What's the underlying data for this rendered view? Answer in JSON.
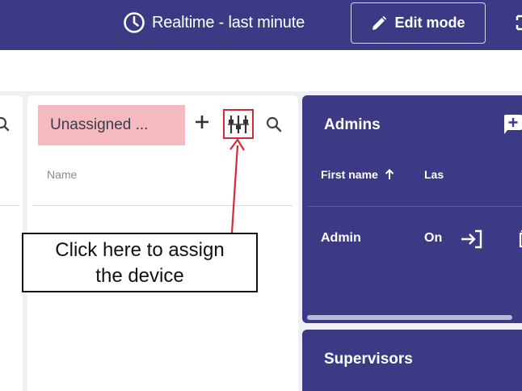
{
  "header": {
    "realtime_label": "Realtime - last minute",
    "edit_mode_label": "Edit mode",
    "background_color": "#3d3a85"
  },
  "unassigned_panel": {
    "title": "Unassigned ...",
    "column_name": "Name",
    "tag_color": "#f5b9c0"
  },
  "callout": {
    "text_line1": "Click here to assign",
    "text_line2": "the device",
    "highlight_color": "#d22b37"
  },
  "admins_panel": {
    "title": "Admins",
    "columns": [
      "First name",
      "Las"
    ],
    "rows": [
      {
        "first_name": "Admin",
        "status": "On"
      }
    ]
  },
  "supervisors_panel": {
    "title": "Supervisors"
  },
  "icons": [
    "clock-icon",
    "pencil-icon",
    "fullscreen-icon",
    "search-icon",
    "plus-icon",
    "assign-device-icon",
    "add-user-icon",
    "sort-ascending-icon",
    "login-icon",
    "delete-icon"
  ]
}
